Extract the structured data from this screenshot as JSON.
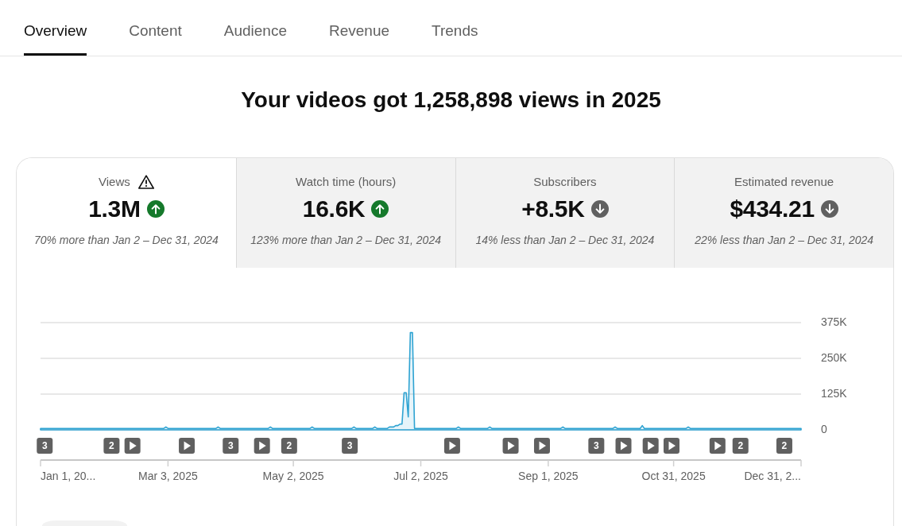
{
  "tabs": [
    {
      "label": "Overview",
      "selected": true
    },
    {
      "label": "Content",
      "selected": false
    },
    {
      "label": "Audience",
      "selected": false
    },
    {
      "label": "Revenue",
      "selected": false
    },
    {
      "label": "Trends",
      "selected": false
    }
  ],
  "headline": "Your videos got 1,258,898 views in 2025",
  "metrics": [
    {
      "label": "Views",
      "warning": true,
      "value": "1.3M",
      "rising": true,
      "comparison": "70% more than Jan 2 – Dec 31, 2024",
      "selected": true
    },
    {
      "label": "Watch time (hours)",
      "warning": false,
      "value": "16.6K",
      "rising": true,
      "comparison": "123% more than Jan 2 – Dec 31, 2024",
      "selected": false
    },
    {
      "label": "Subscribers",
      "warning": false,
      "value": "+8.5K",
      "rising": false,
      "comparison": "14% less than Jan 2 – Dec 31, 2024",
      "selected": false
    },
    {
      "label": "Estimated revenue",
      "warning": false,
      "value": "$434.21",
      "rising": false,
      "comparison": "22% less than Jan 2 – Dec 31, 2024",
      "selected": false
    }
  ],
  "chart": {
    "chart_data": {
      "type": "area",
      "ylim": [
        0,
        375000
      ],
      "categories": [
        "Jan 1, 20...",
        null,
        null,
        null,
        null,
        null,
        null,
        null,
        null,
        null,
        null,
        null,
        null,
        null,
        null,
        null,
        null,
        null,
        null,
        null,
        null,
        null,
        null,
        null,
        null,
        null,
        null,
        null,
        null,
        null,
        null,
        null,
        null,
        null,
        null,
        null,
        null,
        null,
        null,
        null,
        null,
        null,
        null,
        null,
        null,
        null,
        null,
        null,
        null,
        null,
        null,
        null,
        null,
        null,
        null,
        null,
        null,
        null,
        null,
        null,
        null,
        "Mar 3, 2025",
        null,
        null,
        null,
        null,
        null,
        null,
        null,
        null,
        null,
        null,
        null,
        null,
        null,
        null,
        null,
        null,
        null,
        null,
        null,
        null,
        null,
        null,
        null,
        null,
        null,
        null,
        null,
        null,
        null,
        null,
        null,
        null,
        null,
        null,
        null,
        null,
        null,
        null,
        null,
        null,
        null,
        null,
        null,
        null,
        null,
        null,
        null,
        null,
        null,
        null,
        null,
        null,
        null,
        null,
        null,
        null,
        null,
        null,
        null,
        "May 2, 2025",
        null,
        null,
        null,
        null,
        null,
        null,
        null,
        null,
        null,
        null,
        null,
        null,
        null,
        null,
        null,
        null,
        null,
        null,
        null,
        null,
        null,
        null,
        null,
        null,
        null,
        null,
        null,
        null,
        null,
        null,
        null,
        null,
        null,
        null,
        null,
        null,
        null,
        null,
        null,
        null,
        null,
        null,
        null,
        null,
        null,
        null,
        null,
        null,
        null,
        null,
        null,
        null,
        null,
        null,
        null,
        null,
        null,
        null,
        null,
        null,
        "Jul 2, 2025",
        null,
        null,
        null,
        null,
        null,
        null,
        null,
        null,
        null,
        null,
        null,
        null,
        null,
        null,
        null,
        null,
        null,
        null,
        null,
        null,
        null,
        null,
        null,
        null,
        null,
        null,
        null,
        null,
        null,
        null,
        null,
        null,
        null,
        null,
        null,
        null,
        null,
        null,
        null,
        null,
        null,
        null,
        null,
        null,
        null,
        null,
        null,
        null,
        null,
        null,
        null,
        null,
        null,
        null,
        null,
        null,
        null,
        null,
        null,
        null,
        "Sep 1, 2025",
        null,
        null,
        null,
        null,
        null,
        null,
        null,
        null,
        null,
        null,
        null,
        null,
        null,
        null,
        null,
        null,
        null,
        null,
        null,
        null,
        null,
        null,
        null,
        null,
        null,
        null,
        null,
        null,
        null,
        null,
        null,
        null,
        null,
        null,
        null,
        null,
        null,
        null,
        null,
        null,
        null,
        null,
        null,
        null,
        null,
        null,
        null,
        null,
        null,
        null,
        null,
        null,
        null,
        null,
        null,
        null,
        null,
        null,
        null,
        "Oct 31, 2025",
        null,
        null,
        null,
        null,
        null,
        null,
        null,
        null,
        null,
        null,
        null,
        null,
        null,
        null,
        null,
        null,
        null,
        null,
        null,
        null,
        null,
        null,
        null,
        null,
        null,
        null,
        null,
        null,
        null,
        null,
        null,
        null,
        null,
        null,
        null,
        null,
        null,
        null,
        null,
        null,
        null,
        null,
        null,
        null,
        null,
        null,
        null,
        null,
        null,
        null,
        null,
        null,
        null,
        null,
        null,
        null,
        null,
        null,
        null,
        null,
        "Dec 31, 2..."
      ],
      "series": [
        {
          "color": "#2ea3d2",
          "values": [
            5000,
            5000,
            5000,
            5000,
            5000,
            5000,
            5000,
            5000,
            5000,
            5000,
            5000,
            5000,
            5000,
            5000,
            5000,
            5000,
            5000,
            5000,
            5000,
            5000,
            5000,
            5000,
            5000,
            5000,
            5000,
            5000,
            5000,
            5000,
            5000,
            5000,
            5000,
            5000,
            5000,
            5000,
            5000,
            5000,
            5000,
            5000,
            5000,
            5000,
            5000,
            5000,
            5000,
            5000,
            5000,
            5000,
            5000,
            5000,
            5000,
            5000,
            5000,
            5000,
            5000,
            5000,
            5000,
            5000,
            5000,
            5000,
            5000,
            5000,
            10000,
            5000,
            5000,
            5000,
            5000,
            5000,
            5000,
            5000,
            5000,
            5000,
            5000,
            5000,
            5000,
            5000,
            5000,
            5000,
            5000,
            5000,
            5000,
            5000,
            5000,
            5000,
            5000,
            5000,
            5000,
            10000,
            5000,
            5000,
            5000,
            5000,
            5000,
            5000,
            5000,
            5000,
            5000,
            5000,
            5000,
            5000,
            5000,
            5000,
            5000,
            5000,
            5000,
            5000,
            5000,
            5000,
            5000,
            5000,
            5000,
            5000,
            10000,
            5000,
            5000,
            5000,
            5000,
            5000,
            5000,
            5000,
            5000,
            5000,
            5000,
            5000,
            5000,
            5000,
            5000,
            5000,
            5000,
            5000,
            5000,
            5000,
            10000,
            5000,
            5000,
            5000,
            5000,
            5000,
            5000,
            5000,
            5000,
            5000,
            5000,
            5000,
            5000,
            5000,
            5000,
            5000,
            5000,
            5000,
            5000,
            5000,
            10000,
            5000,
            5000,
            5000,
            5000,
            5000,
            5000,
            5000,
            5000,
            5000,
            10000,
            5000,
            5000,
            5000,
            5000,
            5000,
            5000,
            10000,
            10000,
            10000,
            15000,
            15000,
            20000,
            20000,
            130000,
            130000,
            45000,
            340000,
            340000,
            5000,
            5000,
            5000,
            5000,
            5000,
            5000,
            5000,
            5000,
            5000,
            5000,
            5000,
            5000,
            5000,
            5000,
            5000,
            5000,
            5000,
            5000,
            5000,
            5000,
            5000,
            10000,
            5000,
            5000,
            5000,
            5000,
            5000,
            5000,
            5000,
            5000,
            5000,
            5000,
            5000,
            5000,
            5000,
            5000,
            10000,
            5000,
            5000,
            5000,
            5000,
            5000,
            5000,
            5000,
            5000,
            5000,
            5000,
            5000,
            5000,
            5000,
            5000,
            5000,
            5000,
            5000,
            5000,
            5000,
            5000,
            5000,
            5000,
            5000,
            5000,
            5000,
            5000,
            5000,
            5000,
            5000,
            5000,
            5000,
            5000,
            5000,
            5000,
            10000,
            5000,
            5000,
            5000,
            5000,
            5000,
            5000,
            5000,
            5000,
            5000,
            5000,
            5000,
            5000,
            5000,
            5000,
            5000,
            5000,
            5000,
            5000,
            5000,
            5000,
            5000,
            5000,
            5000,
            5000,
            10000,
            5000,
            5000,
            5000,
            5000,
            5000,
            5000,
            5000,
            5000,
            5000,
            5000,
            5000,
            5000,
            15000,
            5000,
            5000,
            5000,
            5000,
            5000,
            5000,
            5000,
            5000,
            5000,
            5000,
            5000,
            5000,
            5000,
            5000,
            5000,
            5000,
            5000,
            5000,
            5000,
            5000,
            5000,
            10000,
            5000,
            5000,
            5000,
            5000,
            5000,
            5000,
            5000,
            5000,
            5000,
            5000,
            5000,
            5000,
            5000,
            5000,
            5000,
            5000,
            5000,
            5000,
            5000,
            5000,
            5000,
            5000,
            5000,
            5000,
            5000,
            5000,
            5000,
            5000,
            5000,
            5000,
            5000,
            5000,
            5000,
            5000,
            5000,
            5000,
            5000,
            5000,
            5000,
            5000,
            5000,
            5000,
            5000,
            5000,
            5000,
            5000,
            5000,
            5000,
            5000,
            5000,
            5000,
            5000,
            5000,
            5000
          ]
        }
      ],
      "yticks": [
        {
          "value": 0,
          "label": "0"
        },
        {
          "value": 125000,
          "label": "125K"
        },
        {
          "value": 250000,
          "label": "250K"
        },
        {
          "value": 375000,
          "label": "375K"
        }
      ]
    },
    "markers": [
      {
        "kind": "count",
        "label": "3"
      },
      {
        "kind": "count",
        "label": "2"
      },
      {
        "kind": "video"
      },
      {
        "kind": "video"
      },
      {
        "kind": "count",
        "label": "3"
      },
      {
        "kind": "video"
      },
      {
        "kind": "count",
        "label": "2"
      },
      {
        "kind": "count",
        "label": "3"
      },
      {
        "kind": "video"
      },
      {
        "kind": "video"
      },
      {
        "kind": "video"
      },
      {
        "kind": "count",
        "label": "3"
      },
      {
        "kind": "video"
      },
      {
        "kind": "video"
      },
      {
        "kind": "video"
      },
      {
        "kind": "video"
      },
      {
        "kind": "count",
        "label": "2"
      },
      {
        "kind": "count",
        "label": "2"
      }
    ]
  }
}
